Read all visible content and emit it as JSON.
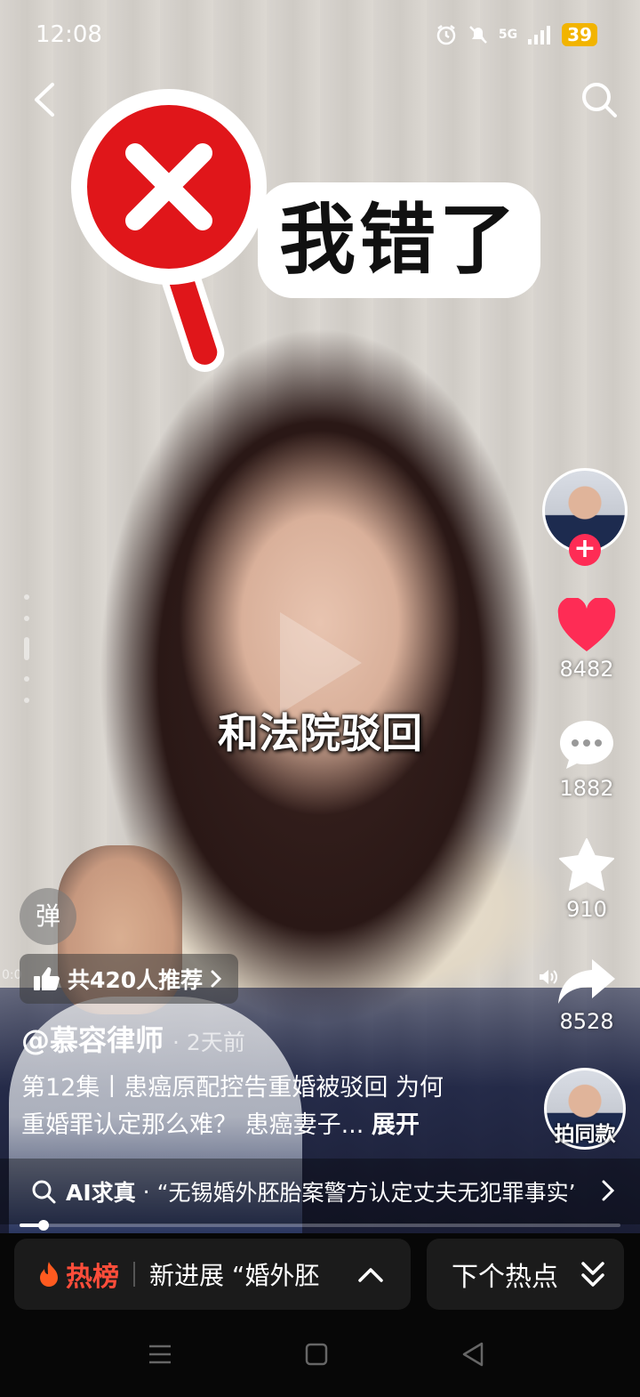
{
  "status_bar": {
    "time": "12:08",
    "network": "5G",
    "battery": "39"
  },
  "video": {
    "sticker_text": "我错了",
    "subtitle": "和法院驳回",
    "elapsed_time": "0:0",
    "progress_fraction": 0.04
  },
  "side_actions": {
    "likes": "8482",
    "comments": "1882",
    "favorites": "910",
    "shares": "8528",
    "same_style_label": "拍同款"
  },
  "danmu": {
    "label": "弹"
  },
  "recommend": {
    "text": "共420人推荐"
  },
  "post": {
    "author": "@慕容律师",
    "time_ago": "· 2天前",
    "desc_line1": "第12集丨患癌原配控告重婚被驳回 为何",
    "desc_line2": "重婚罪认定那么难？ 患癌妻子...",
    "expand_label": "展开"
  },
  "ai_bar": {
    "label": "AI求真",
    "dot": "·",
    "text": "“无锡婚外胚胎案警方认定丈夫无犯罪事实”"
  },
  "bottom": {
    "hot_label": "热榜",
    "hot_text": "新进展 “婚外胚",
    "next_label": "下个热点"
  },
  "colors": {
    "like": "#fe2c55",
    "hot": "#ff4d3a",
    "battery": "#f2b400"
  }
}
